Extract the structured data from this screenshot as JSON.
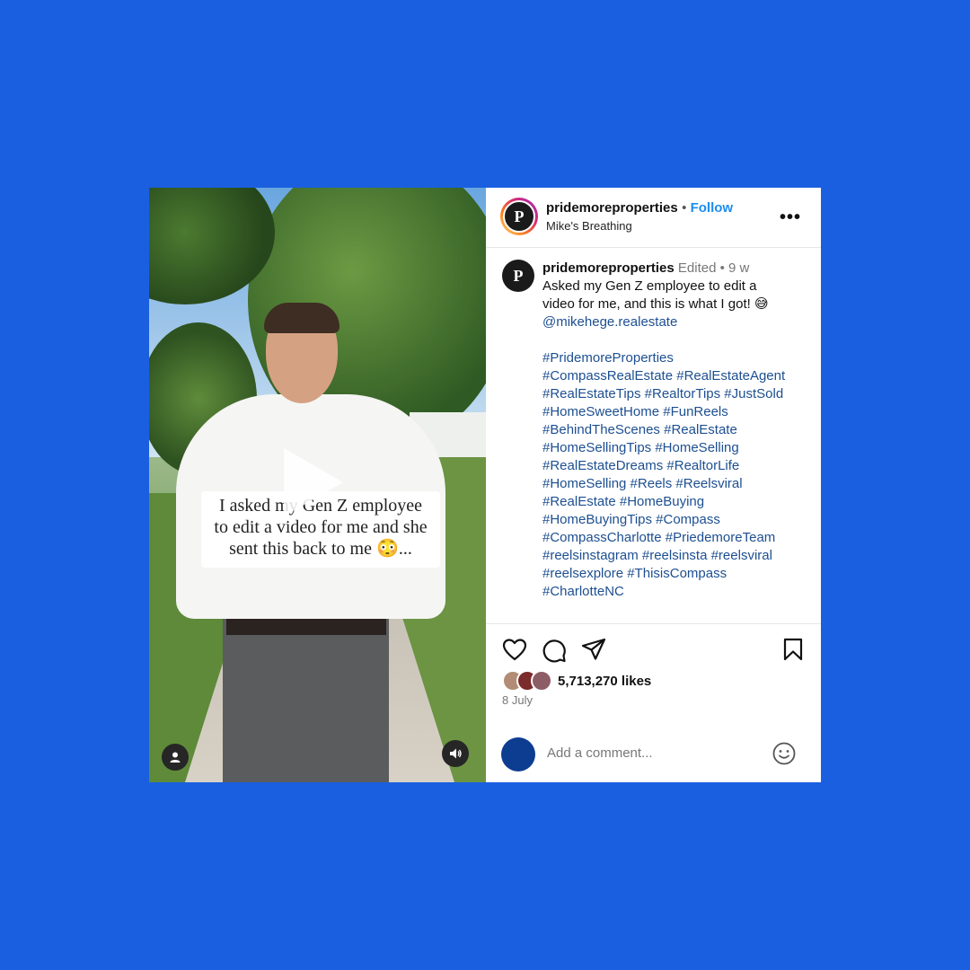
{
  "post": {
    "username": "pridemoreproperties",
    "follow_label": "Follow",
    "audio_label": "Mike's Breathing",
    "more_label": "•••",
    "avatar_letter": "P"
  },
  "video": {
    "caption_lines": [
      "I asked my Gen Z employee",
      "to edit a video for me and she",
      "sent this back to me 😳..."
    ]
  },
  "comment": {
    "username": "pridemoreproperties",
    "edited": "Edited",
    "time": "9 w",
    "text_line1": "Asked my Gen Z employee to edit a",
    "text_line2": "video for me, and this is what I got! 😅",
    "mention": "@mikehege.realestate",
    "hashtag_lines": [
      "#PridemoreProperties",
      "#CompassRealEstate #RealEstateAgent",
      "#RealEstateTips #RealtorTips #JustSold",
      "#HomeSweetHome #FunReels",
      "#BehindTheScenes #RealEstate",
      "#HomeSellingTips #HomeSelling",
      "#RealEstateDreams #RealtorLife",
      "#HomeSelling #Reels #Reelsviral",
      "#RealEstate #HomeBuying",
      "#HomeBuyingTips #Compass",
      "#CompassCharlotte #PriedemoreTeam",
      "#reelsinstagram #reelsinsta #reelsviral",
      "#reelsexplore #ThisisCompass",
      "#CharlotteNC"
    ]
  },
  "engagement": {
    "likes": "5,713,270 likes",
    "date": "8 July"
  },
  "add_comment": {
    "placeholder": "Add a comment..."
  },
  "colors": {
    "background": "#1a5fe0",
    "follow": "#1d8cf0",
    "hashtag": "#1d4f91"
  }
}
